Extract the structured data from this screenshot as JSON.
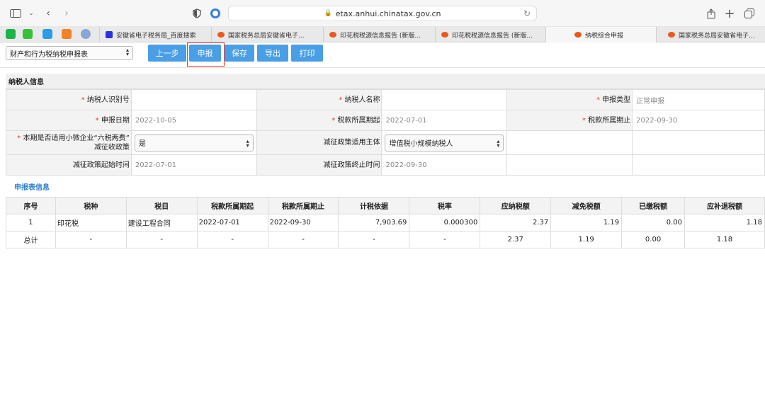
{
  "browser": {
    "url": "etax.anhui.chinatax.gov.cn",
    "tabs": [
      {
        "label": "安徽省电子税务局_百度搜索"
      },
      {
        "label": "国家税务总局安徽省电子..."
      },
      {
        "label": "印花税税源信息报告 (新版..."
      },
      {
        "label": "印花税税源信息报告 (新版..."
      },
      {
        "label": "纳税综合申报"
      },
      {
        "label": "国家税务总局安徽省电子..."
      }
    ]
  },
  "toolbar": {
    "form_select": "财产和行为税纳税申报表",
    "prev_label": "上一步",
    "declare_label": "申报",
    "save_label": "保存",
    "export_label": "导出",
    "print_label": "打印"
  },
  "taxpayer": {
    "section_title": "纳税人信息",
    "id_label": "纳税人识别号",
    "name_label": "纳税人名称",
    "declare_type_label": "申报类型",
    "declare_type_value": "正常申报",
    "declare_date_label": "申报日期",
    "declare_date_value": "2022-10-05",
    "period_start_label": "税款所属期起",
    "period_start_value": "2022-07-01",
    "period_end_label": "税款所属期止",
    "period_end_value": "2022-09-30",
    "policy_label_1": "本期是否适用小微企业“六税两费”",
    "policy_label_2": "减征收政策",
    "policy_value": "是",
    "subject_label": "减征政策适用主体",
    "subject_value": "增值税小规模纳税人",
    "policy_start_label": "减征政策起始时间",
    "policy_start_value": "2022-07-01",
    "policy_end_label": "减征政策终止时间",
    "policy_end_value": "2022-09-30"
  },
  "detail": {
    "section_title": "申报表信息",
    "headers": [
      "序号",
      "税种",
      "税目",
      "税款所属期起",
      "税款所属期止",
      "计税依据",
      "税率",
      "应纳税额",
      "减免税额",
      "已缴税额",
      "应补退税额"
    ],
    "row": [
      "1",
      "印花税",
      "建设工程合同",
      "2022-07-01",
      "2022-09-30",
      "7,903.69",
      "0.000300",
      "2.37",
      "1.19",
      "0.00",
      "1.18"
    ],
    "total": [
      "总计",
      "-",
      "-",
      "-",
      "-",
      "-",
      "-",
      "2.37",
      "1.19",
      "0.00",
      "1.18"
    ]
  }
}
